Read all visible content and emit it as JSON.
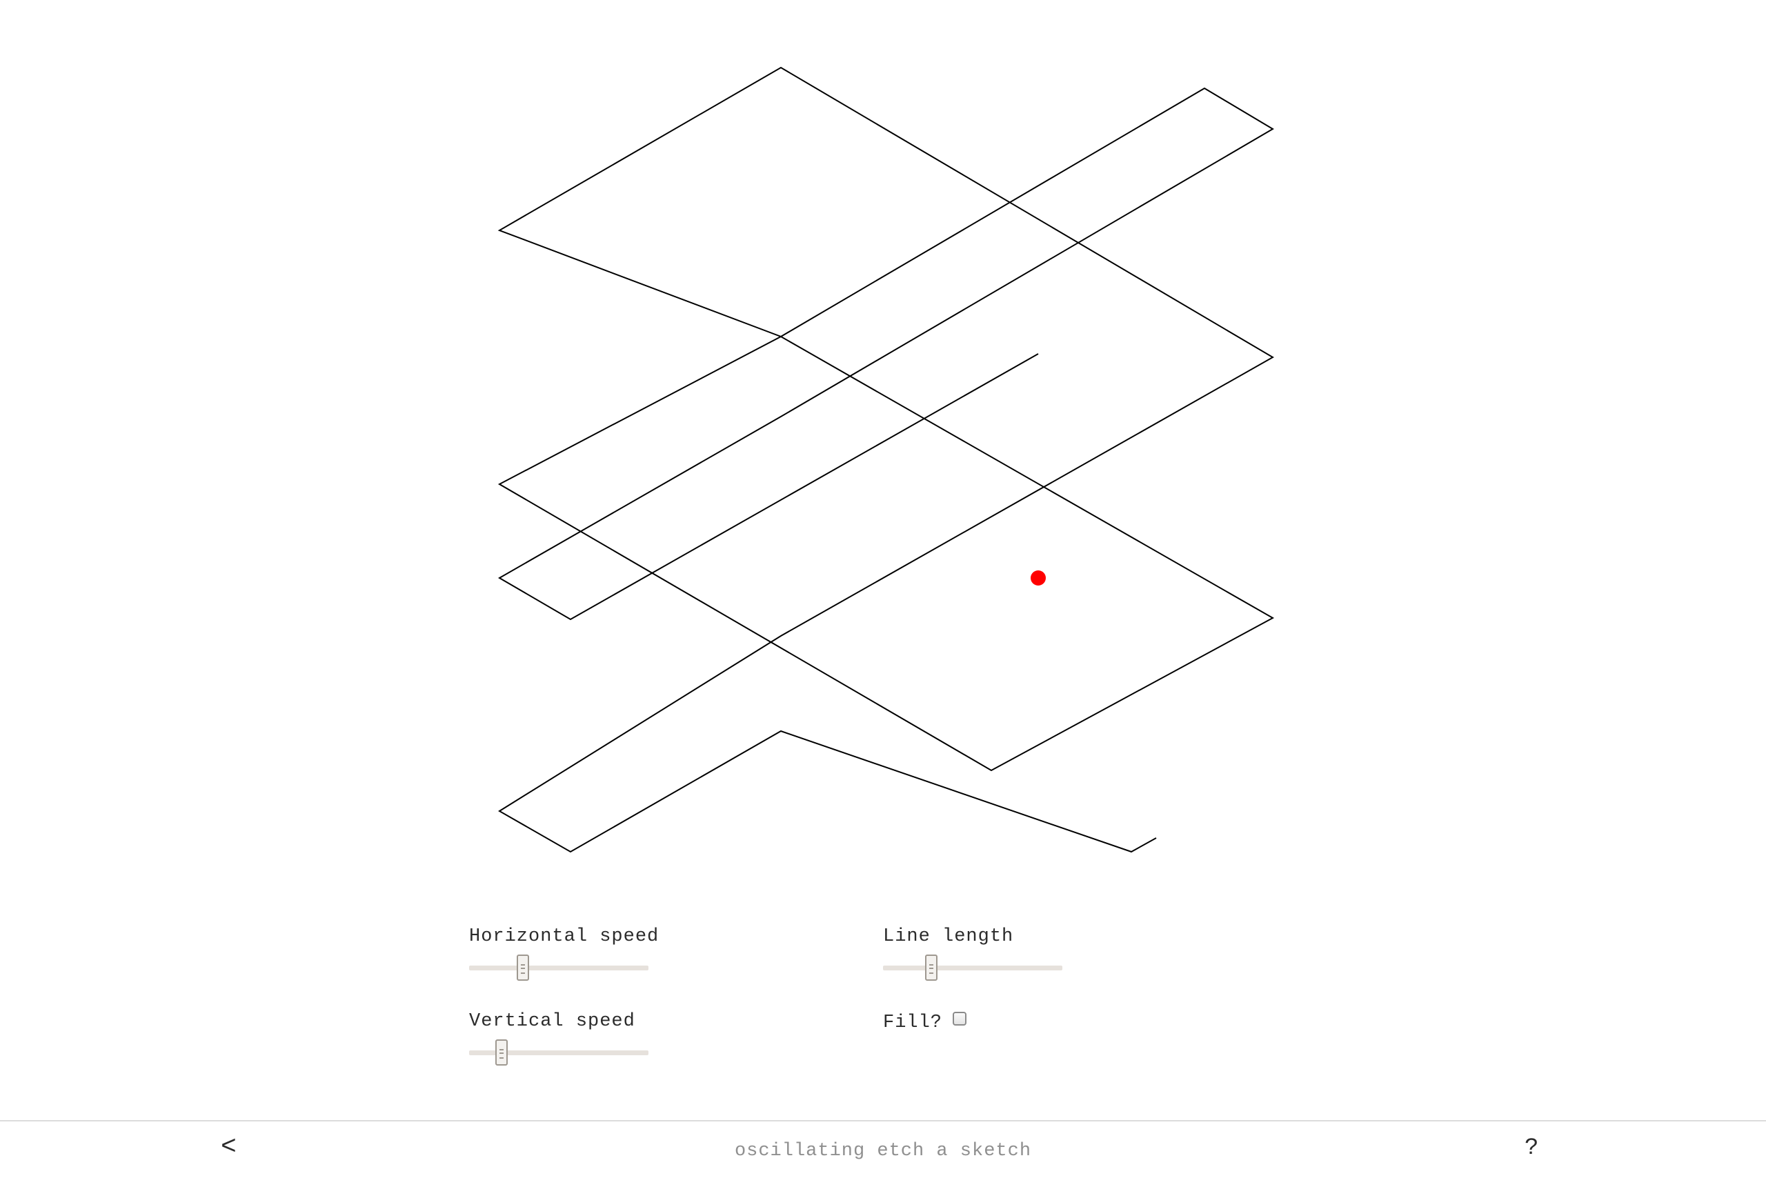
{
  "controls": {
    "horizontal_speed": {
      "label": "Horizontal speed",
      "value": 0.3
    },
    "vertical_speed": {
      "label": "Vertical speed",
      "value": 0.18
    },
    "line_length": {
      "label": "Line length",
      "value": 0.27
    },
    "fill": {
      "label": "Fill?",
      "checked": false
    }
  },
  "footer": {
    "back_label": "<",
    "title": "oscillating etch a sketch",
    "help_label": "?"
  },
  "colors": {
    "line": "#000000",
    "pen": "#ff0000",
    "slider_track": "#e6e1dc"
  }
}
